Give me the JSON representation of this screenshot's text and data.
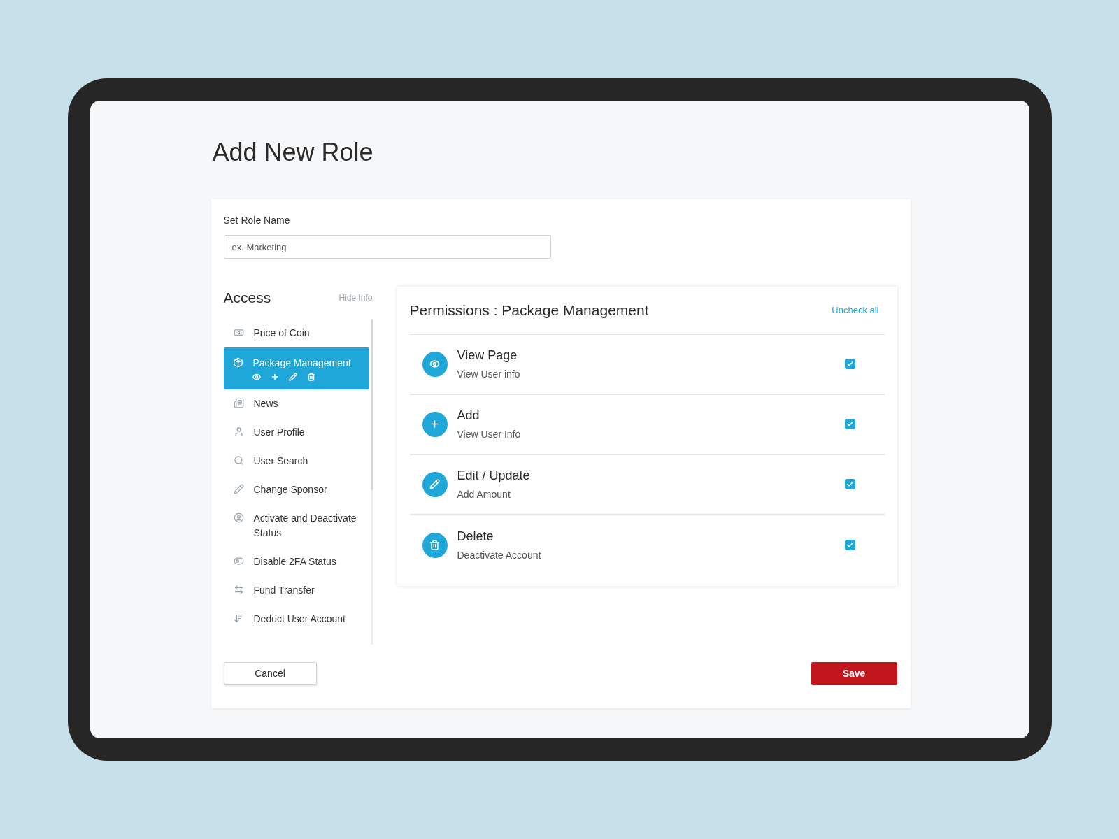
{
  "page": {
    "title": "Add New Role"
  },
  "role_name": {
    "label": "Set Role Name",
    "placeholder": "ex. Marketing"
  },
  "access": {
    "title": "Access",
    "hide_info": "Hide Info",
    "items": [
      {
        "label": "Price of Coin",
        "selected": false
      },
      {
        "label": "Package Management",
        "selected": true
      },
      {
        "label": "News",
        "selected": false
      },
      {
        "label": "User Profile",
        "selected": false
      },
      {
        "label": "User Search",
        "selected": false
      },
      {
        "label": "Change Sponsor",
        "selected": false
      },
      {
        "label": "Activate and Deactivate Status",
        "selected": false
      },
      {
        "label": "Disable 2FA Status",
        "selected": false
      },
      {
        "label": "Fund Transfer",
        "selected": false
      },
      {
        "label": "Deduct User Account",
        "selected": false
      }
    ]
  },
  "permissions": {
    "title": "Permissions : Package Management",
    "uncheck_all": "Uncheck all",
    "items": [
      {
        "title": "View Page",
        "subtitle": "View User info",
        "checked": true
      },
      {
        "title": "Add",
        "subtitle": "View User Info",
        "checked": true
      },
      {
        "title": "Edit / Update",
        "subtitle": "Add Amount",
        "checked": true
      },
      {
        "title": "Delete",
        "subtitle": "Deactivate Account",
        "checked": true
      }
    ]
  },
  "buttons": {
    "cancel": "Cancel",
    "save": "Save"
  }
}
